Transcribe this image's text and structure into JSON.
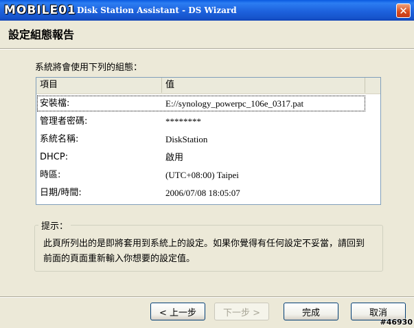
{
  "titlebar": {
    "title": "Disk Station Assistant - DS Wizard",
    "logo_text": "MOBILE01",
    "close_glyph": "✕"
  },
  "header": {
    "title": "設定組態報告"
  },
  "intro": "系統將會使用下列的組態：",
  "listview": {
    "columns": [
      "項目",
      "值"
    ],
    "rows": [
      {
        "key": "安裝檔:",
        "value": "E://synology_powerpc_106e_0317.pat"
      },
      {
        "key": "管理者密碼:",
        "value": "********"
      },
      {
        "key": "系統名稱:",
        "value": "DiskStation"
      },
      {
        "key": "DHCP:",
        "value": "啟用"
      },
      {
        "key": "時區:",
        "value": "(UTC+08:00) Taipei"
      },
      {
        "key": "日期/時間:",
        "value": "2006/07/08 18:05:07"
      }
    ]
  },
  "hint": {
    "label": "提示：",
    "text": "此頁所列出的是即將套用到系統上的設定。如果你覺得有任何設定不妥當，請回到前面的頁面重新輸入你想要的設定值。"
  },
  "buttons": {
    "back": "< 上一步",
    "next": "下一步 >",
    "finish": "完成",
    "cancel": "取消"
  },
  "watermark": "#46930",
  "colors": {
    "titlebar": "#1d62dd",
    "face": "#ece9d8",
    "list_border": "#7f9db9"
  }
}
